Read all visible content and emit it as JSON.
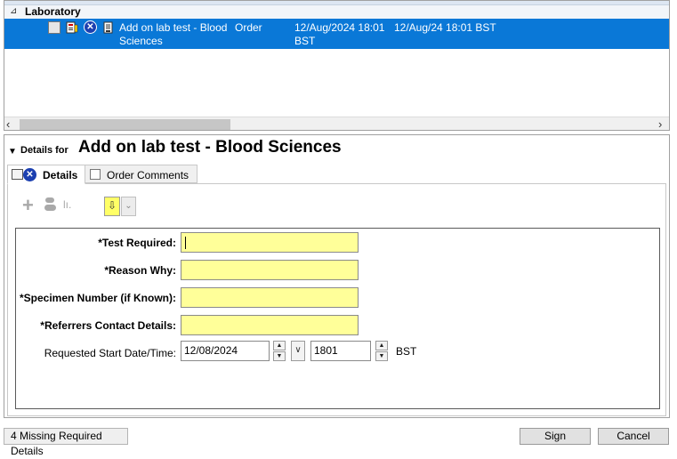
{
  "orders": {
    "group_toggle": "⊿",
    "group_label": "Laboratory",
    "selected_row": {
      "name": "Add on lab test - Blood Sciences",
      "type": "Order",
      "start": "12/Aug/2024 18:01 BST",
      "stop": "12/Aug/24 18:01 BST"
    },
    "scroll_left_glyph": "‹",
    "scroll_right_glyph": "›"
  },
  "details": {
    "collapse_glyph": "▼",
    "header_prefix": "Details for",
    "header_title": "Add on lab test - Blood Sciences",
    "tabs": [
      {
        "label": "Details"
      },
      {
        "label": "Order Comments"
      }
    ],
    "toolbar": {
      "plus_glyph": "+",
      "bars_glyph": "lı.",
      "arrow_down_glyph": "⇩",
      "double_down_glyph": "⌄"
    },
    "form": {
      "fields": [
        {
          "label": "*Test Required:",
          "value": ""
        },
        {
          "label": "*Reason Why:",
          "value": ""
        },
        {
          "label": "*Specimen Number (if Known):",
          "value": ""
        },
        {
          "label": "*Referrers Contact Details:",
          "value": ""
        }
      ],
      "start_label": "Requested Start Date/Time:",
      "start_date": "12/08/2024",
      "start_time": "1801",
      "timezone": "BST",
      "spin_up": "▲",
      "spin_down": "▼",
      "dropdown_glyph": "∨"
    }
  },
  "footer": {
    "missing": "4 Missing Required Details",
    "sign": "Sign",
    "cancel": "Cancel"
  },
  "colors": {
    "selection": "#0a78d7",
    "required_field": "#ffff99",
    "status_icon": "#1b3fb0"
  }
}
